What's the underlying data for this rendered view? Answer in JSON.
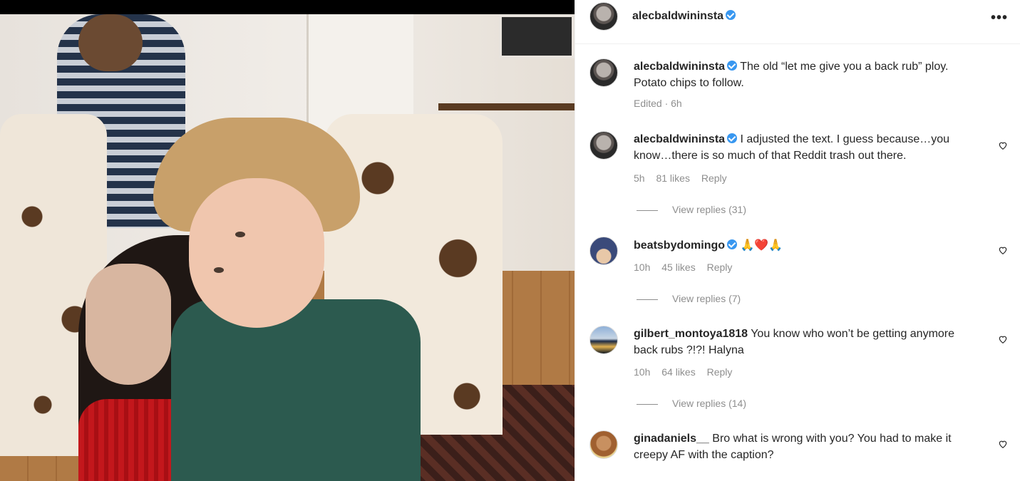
{
  "post": {
    "author": "alecbaldwininsta",
    "more_icon": "more-horizontal-icon",
    "caption": "The old “let me give you a back rub” ploy. Potato chips to follow.",
    "caption_meta": "Edited · 6h"
  },
  "comments": [
    {
      "username": "alecbaldwininsta",
      "verified": true,
      "text": "I adjusted the text. I guess because…you know…there is so much of that Reddit trash out there.",
      "time": "5h",
      "likes": "81 likes",
      "reply": "Reply",
      "view_replies": "View replies (31)"
    },
    {
      "username": "beatsbydomingo",
      "verified": true,
      "text": "🙏❤️🙏",
      "time": "10h",
      "likes": "45 likes",
      "reply": "Reply",
      "view_replies": "View replies (7)"
    },
    {
      "username": "gilbert_montoya1818",
      "verified": false,
      "text": "You know who won’t be getting anymore back rubs ?!?! Halyna",
      "time": "10h",
      "likes": "64 likes",
      "reply": "Reply",
      "view_replies": "View replies (14)"
    },
    {
      "username": "ginadaniels__",
      "verified": false,
      "text": "Bro what is wrong with you? You had to make it creepy AF with the caption?"
    }
  ],
  "colors": {
    "verified_badge": "#3897f0",
    "meta_text": "#8e8e8e",
    "primary_text": "#262626"
  }
}
